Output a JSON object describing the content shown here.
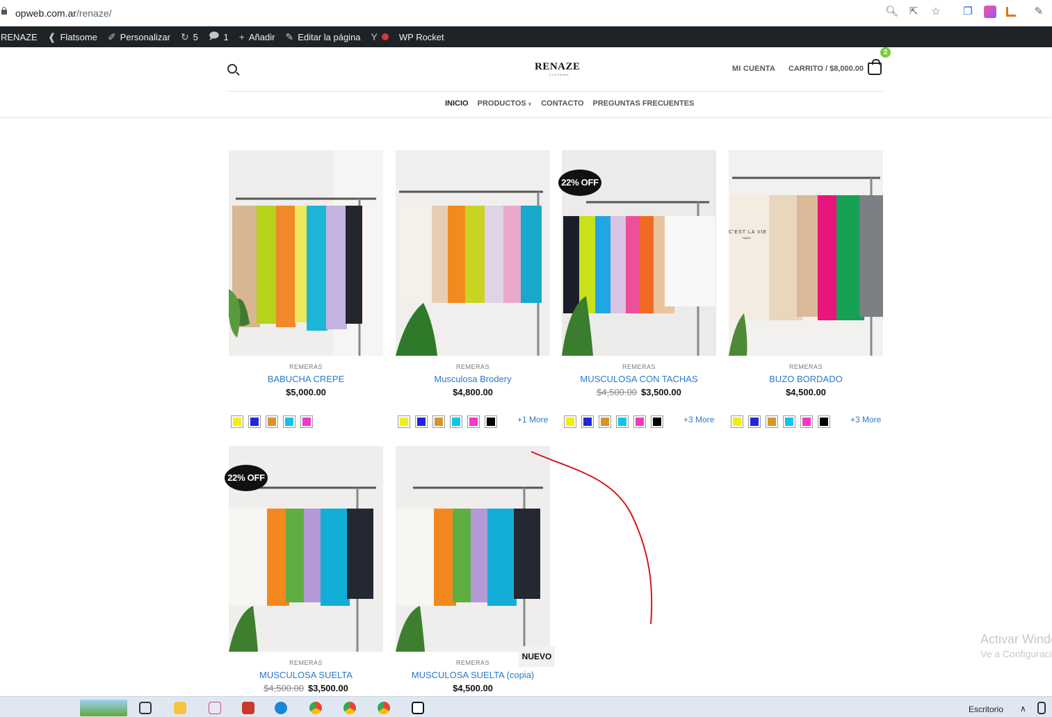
{
  "browser": {
    "url_host": "opweb.com.ar",
    "url_path": "/renaze/"
  },
  "wp_bar": {
    "site": "RENAZE",
    "theme": "Flatsome",
    "customize": "Personalizar",
    "updates": "5",
    "comments": "1",
    "add": "Añadir",
    "edit": "Editar la página",
    "rocket": "WP Rocket"
  },
  "header": {
    "logo": "RENAZE",
    "logo_sub": "CLOTHING",
    "account": "MI CUENTA",
    "cart": "CARRITO / $8,000.00",
    "cart_count": "2",
    "nav": [
      "INICIO",
      "PRODUCTOS",
      "CONTACTO",
      "PREGUNTAS FRECUENTES"
    ]
  },
  "colors": {
    "link": "#2a7ac5",
    "swatch_yellow": "#f2ee10",
    "swatch_blue": "#2426d9",
    "swatch_mustard": "#d6952c",
    "swatch_cyan": "#10c4e6",
    "swatch_pink": "#f536c6",
    "swatch_black": "#000000",
    "annotation": "#d8141a"
  },
  "products": [
    {
      "category": "REMERAS",
      "name": "BABUCHA CREPE",
      "price": "$5,000.00",
      "old_price": "",
      "more": "",
      "badge": ""
    },
    {
      "category": "REMERAS",
      "name": "Musculosa Brodery",
      "price": "$4,800.00",
      "old_price": "",
      "more": "+1 More",
      "badge": ""
    },
    {
      "category": "REMERAS",
      "name": "MUSCULOSA CON TACHAS",
      "price": "$3,500.00",
      "old_price": "$4,500.00",
      "more": "+3 More",
      "badge": "22% OFF"
    },
    {
      "category": "REMERAS",
      "name": "BUZO BORDADO",
      "price": "$4,500.00",
      "old_price": "",
      "more": "+3 More",
      "badge": ""
    },
    {
      "category": "REMERAS",
      "name": "MUSCULOSA SUELTA",
      "price": "$3,500.00",
      "old_price": "$4,500.00",
      "more": "",
      "badge": "22% OFF"
    },
    {
      "category": "REMERAS",
      "name": "MUSCULOSA SUELTA (copia)",
      "price": "$4,500.00",
      "old_price": "",
      "more": "",
      "badge": "NUEVO"
    }
  ],
  "watermark": {
    "line1": "Activar Windows",
    "line2": "Ve a Configuración"
  },
  "taskbar": {
    "desktop_label": "Escritorio"
  }
}
